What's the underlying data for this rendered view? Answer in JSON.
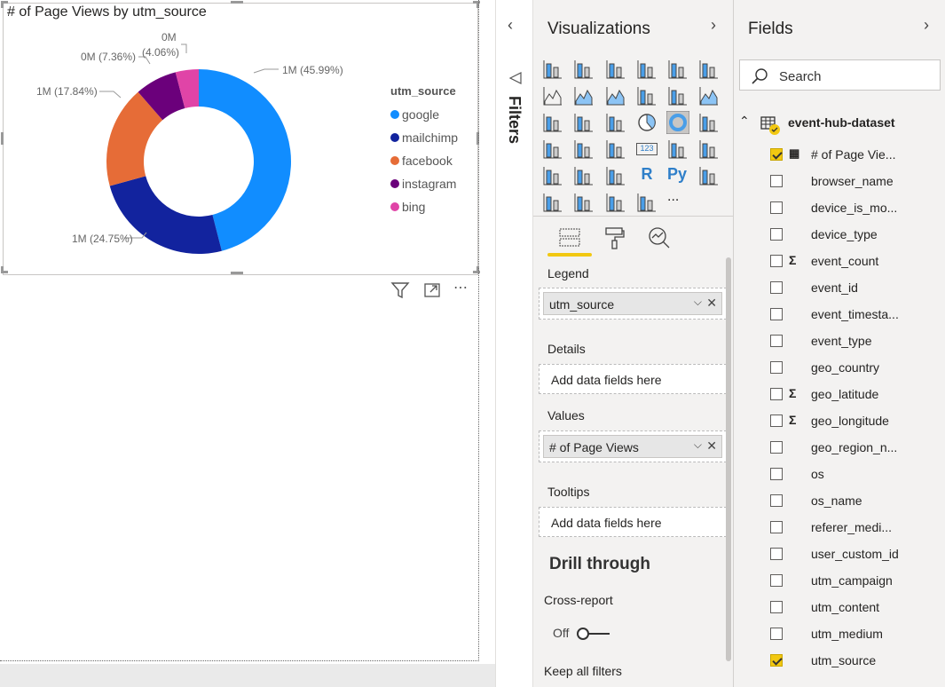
{
  "visual": {
    "title": "# of Page Views by utm_source",
    "legend_title": "utm_source"
  },
  "chart_data": {
    "type": "pie",
    "variant": "donut",
    "title": "# of Page Views by utm_source",
    "legend_title": "utm_source",
    "legend_position": "right",
    "categories": [
      "google",
      "mailchimp",
      "facebook",
      "instagram",
      "bing"
    ],
    "values_percent": [
      45.99,
      24.75,
      17.84,
      7.36,
      4.06
    ],
    "data_labels": [
      "1M (45.99%)",
      "1M (24.75%)",
      "1M (17.84%)",
      "0M (7.36%)",
      "0M (4.06%)"
    ],
    "bing_label_parts": [
      "0M",
      "(4.06%)"
    ],
    "colors": [
      "#118dff",
      "#12239e",
      "#e66c37",
      "#6b007b",
      "#e044a7"
    ]
  },
  "filters": {
    "label": "Filters"
  },
  "viz_pane": {
    "title": "Visualizations",
    "more": "...",
    "icons": [
      "stacked-bar",
      "stacked-column",
      "clustered-bar",
      "clustered-column",
      "100-stacked-bar",
      "100-stacked-column",
      "line",
      "area",
      "stacked-area",
      "line-clustered-column",
      "line-stacked-column",
      "ribbon",
      "waterfall",
      "funnel",
      "scatter",
      "pie",
      "donut",
      "treemap",
      "map",
      "filled-map",
      "gauge",
      "card",
      "multi-row-card",
      "kpi",
      "slicer",
      "table",
      "matrix",
      "r-visual",
      "python-visual",
      "key-influencers",
      "decomposition-tree",
      "qa",
      "arcgis",
      "power-apps"
    ],
    "r_label": "R",
    "py_label": "Py",
    "card_label": "123",
    "wells": {
      "legend": {
        "title": "Legend",
        "value": "utm_source"
      },
      "details": {
        "title": "Details",
        "placeholder": "Add data fields here"
      },
      "values": {
        "title": "Values",
        "value": "# of Page Views"
      },
      "tooltips": {
        "title": "Tooltips",
        "placeholder": "Add data fields here"
      }
    },
    "drill": {
      "title": "Drill through",
      "cross_report": "Cross-report",
      "toggle": "Off",
      "keep_filters": "Keep all filters"
    }
  },
  "fields_pane": {
    "title": "Fields",
    "search_placeholder": "Search",
    "dataset": "event-hub-dataset",
    "fields": [
      {
        "name": "# of Page Vie...",
        "checked": true,
        "type": "measure"
      },
      {
        "name": "browser_name",
        "checked": false,
        "type": ""
      },
      {
        "name": "device_is_mo...",
        "checked": false,
        "type": ""
      },
      {
        "name": "device_type",
        "checked": false,
        "type": ""
      },
      {
        "name": "event_count",
        "checked": false,
        "type": "sum"
      },
      {
        "name": "event_id",
        "checked": false,
        "type": ""
      },
      {
        "name": "event_timesta...",
        "checked": false,
        "type": ""
      },
      {
        "name": "event_type",
        "checked": false,
        "type": ""
      },
      {
        "name": "geo_country",
        "checked": false,
        "type": ""
      },
      {
        "name": "geo_latitude",
        "checked": false,
        "type": "sum"
      },
      {
        "name": "geo_longitude",
        "checked": false,
        "type": "sum"
      },
      {
        "name": "geo_region_n...",
        "checked": false,
        "type": ""
      },
      {
        "name": "os",
        "checked": false,
        "type": ""
      },
      {
        "name": "os_name",
        "checked": false,
        "type": ""
      },
      {
        "name": "referer_medi...",
        "checked": false,
        "type": ""
      },
      {
        "name": "user_custom_id",
        "checked": false,
        "type": ""
      },
      {
        "name": "utm_campaign",
        "checked": false,
        "type": ""
      },
      {
        "name": "utm_content",
        "checked": false,
        "type": ""
      },
      {
        "name": "utm_medium",
        "checked": false,
        "type": ""
      },
      {
        "name": "utm_source",
        "checked": true,
        "type": ""
      }
    ]
  }
}
